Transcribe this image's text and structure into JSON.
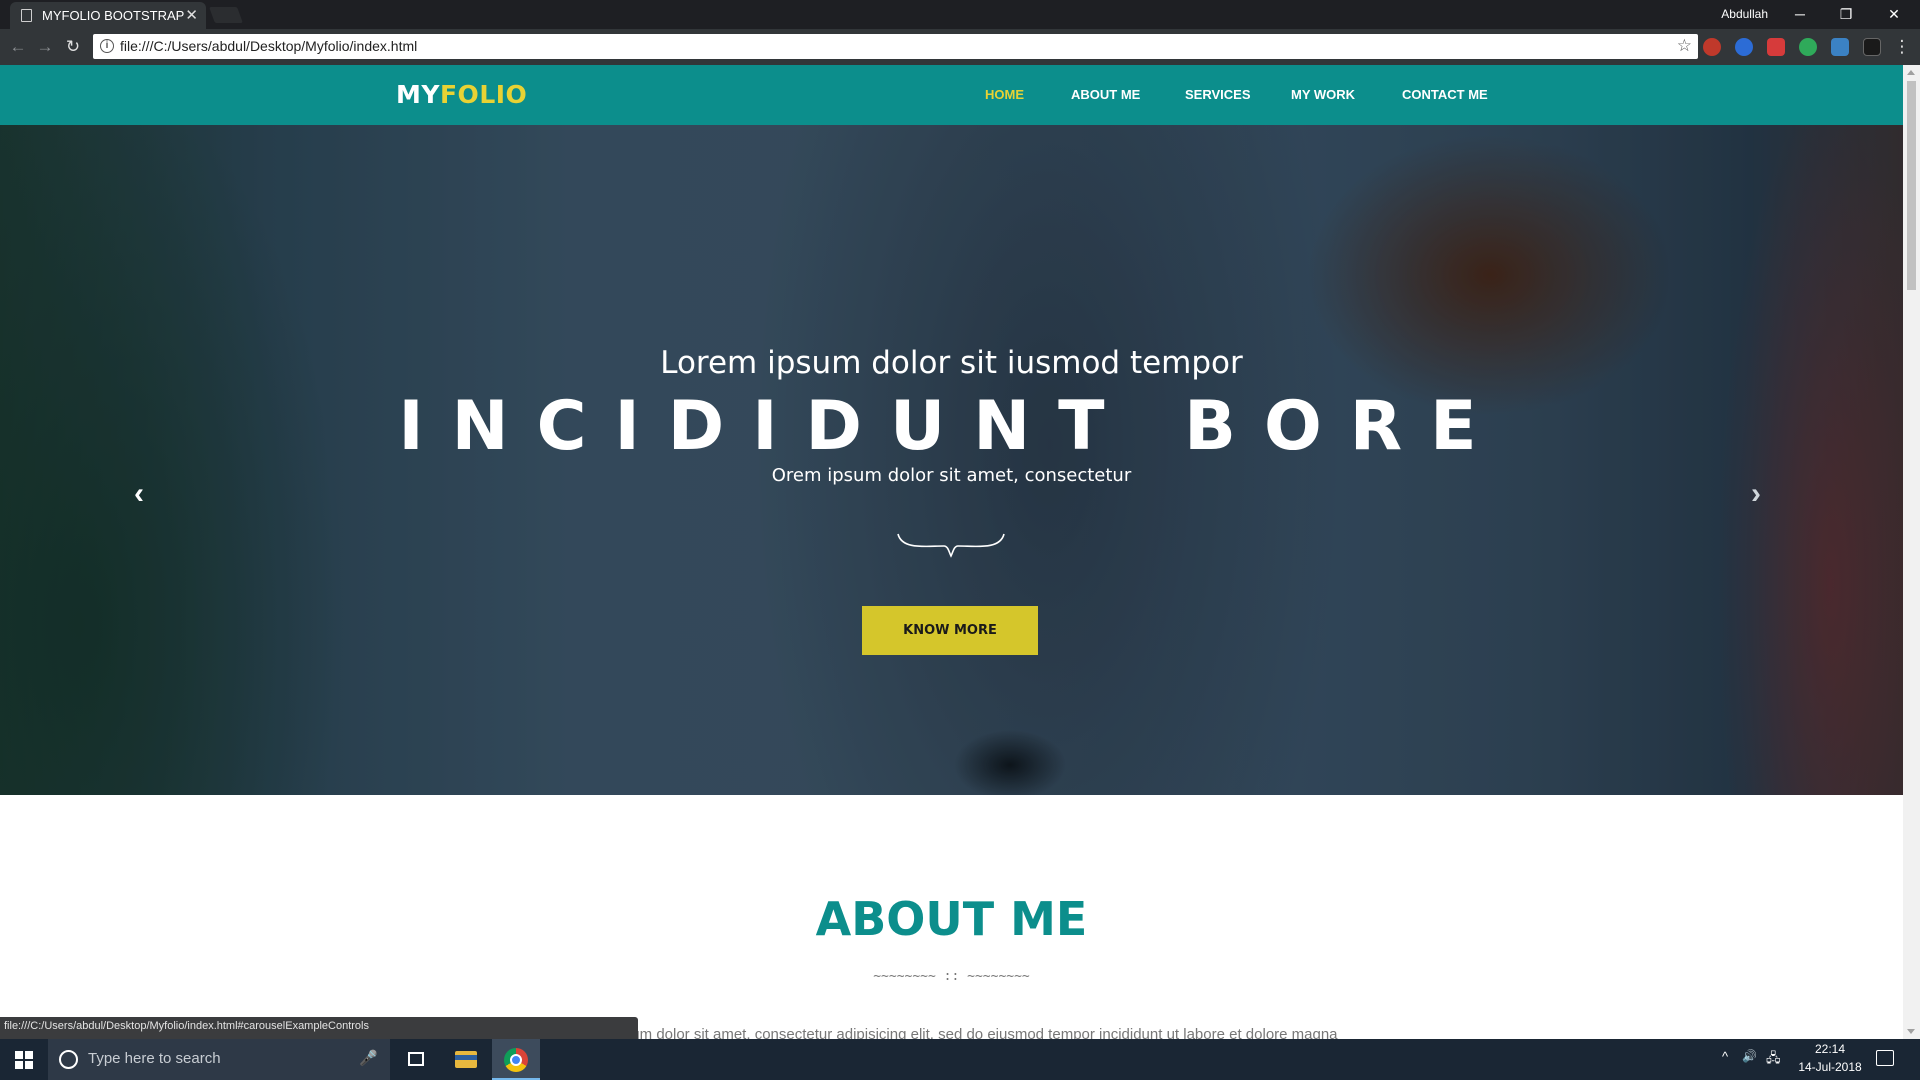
{
  "browser": {
    "tab_title": "MYFOLIO BOOTSTRAP",
    "tab_close": "✕",
    "user_name": "Abdullah",
    "url": "file:///C:/Users/abdul/Desktop/Myfolio/index.html",
    "window_controls": {
      "minimize": "─",
      "restore": "❐",
      "close": "✕"
    },
    "nav": {
      "back": "←",
      "forward": "→",
      "reload": "↻"
    },
    "star": "☆",
    "info": "i",
    "extension_colors": [
      "#c0392b",
      "#2c6cd6",
      "#d63b3b",
      "#2faa5a",
      "#3b82c4",
      "#1a1a1a"
    ]
  },
  "site": {
    "brand": {
      "part1": "MY",
      "part2": "FOLIO"
    },
    "menu": [
      {
        "label": "HOME",
        "active": true
      },
      {
        "label": "ABOUT ME",
        "active": false
      },
      {
        "label": "SERVICES",
        "active": false
      },
      {
        "label": "MY WORK",
        "active": false
      },
      {
        "label": "CONTACT ME",
        "active": false
      }
    ],
    "hero": {
      "subtitle": "Lorem ipsum dolor sit iusmod tempor",
      "title": "INCIDIDUNT BORE",
      "caption": "Orem ipsum dolor sit amet, consectetur",
      "button_label": "KNOW MORE",
      "prev_arrow": "‹",
      "next_arrow": "›"
    },
    "about": {
      "title": "ABOUT ME",
      "divider": "~~~~~~~~ :: ~~~~~~~~",
      "text": "Lorem ipsum dolor sit amet, consectetur adipisicing elit, sed do eiusmod tempor incididunt ut labore et dolore magna"
    },
    "colors": {
      "primary": "#0c8e8c",
      "accent": "#e8d234",
      "button": "#d5c62b"
    }
  },
  "status_bar": "file:///C:/Users/abdul/Desktop/Myfolio/index.html#carouselExampleControls",
  "taskbar": {
    "search_placeholder": "Type here to search",
    "mic": "🎤",
    "tray": {
      "chevron": "^",
      "volume": "🔊",
      "network": "🖧"
    },
    "time": "22:14",
    "date": "14-Jul-2018"
  }
}
